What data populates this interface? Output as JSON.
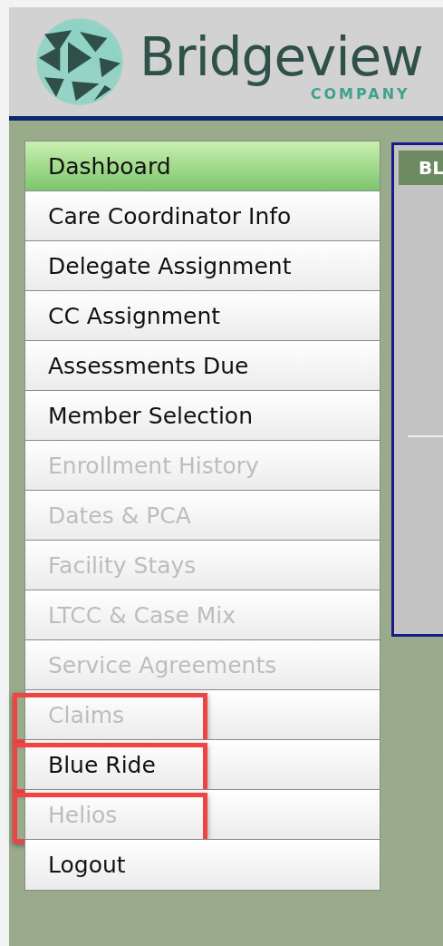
{
  "header": {
    "brand": "Bridgeview",
    "tagline": "COMPANY"
  },
  "menu": [
    {
      "label": "Dashboard",
      "selected": true,
      "disabled": false,
      "highlighted": false
    },
    {
      "label": "Care Coordinator Info",
      "selected": false,
      "disabled": false,
      "highlighted": false
    },
    {
      "label": "Delegate Assignment",
      "selected": false,
      "disabled": false,
      "highlighted": false
    },
    {
      "label": "CC Assignment",
      "selected": false,
      "disabled": false,
      "highlighted": false
    },
    {
      "label": "Assessments Due",
      "selected": false,
      "disabled": false,
      "highlighted": false
    },
    {
      "label": "Member Selection",
      "selected": false,
      "disabled": false,
      "highlighted": false
    },
    {
      "label": "Enrollment History",
      "selected": false,
      "disabled": true,
      "highlighted": false
    },
    {
      "label": "Dates & PCA",
      "selected": false,
      "disabled": true,
      "highlighted": false
    },
    {
      "label": "Facility Stays",
      "selected": false,
      "disabled": true,
      "highlighted": false
    },
    {
      "label": "LTCC & Case Mix",
      "selected": false,
      "disabled": true,
      "highlighted": false
    },
    {
      "label": "Service Agreements",
      "selected": false,
      "disabled": true,
      "highlighted": false
    },
    {
      "label": "Claims",
      "selected": false,
      "disabled": true,
      "highlighted": true
    },
    {
      "label": "Blue Ride",
      "selected": false,
      "disabled": false,
      "highlighted": true
    },
    {
      "label": "Helios",
      "selected": false,
      "disabled": true,
      "highlighted": true
    },
    {
      "label": "Logout",
      "selected": false,
      "disabled": false,
      "highlighted": false
    }
  ],
  "panel": {
    "heading": "BL"
  }
}
